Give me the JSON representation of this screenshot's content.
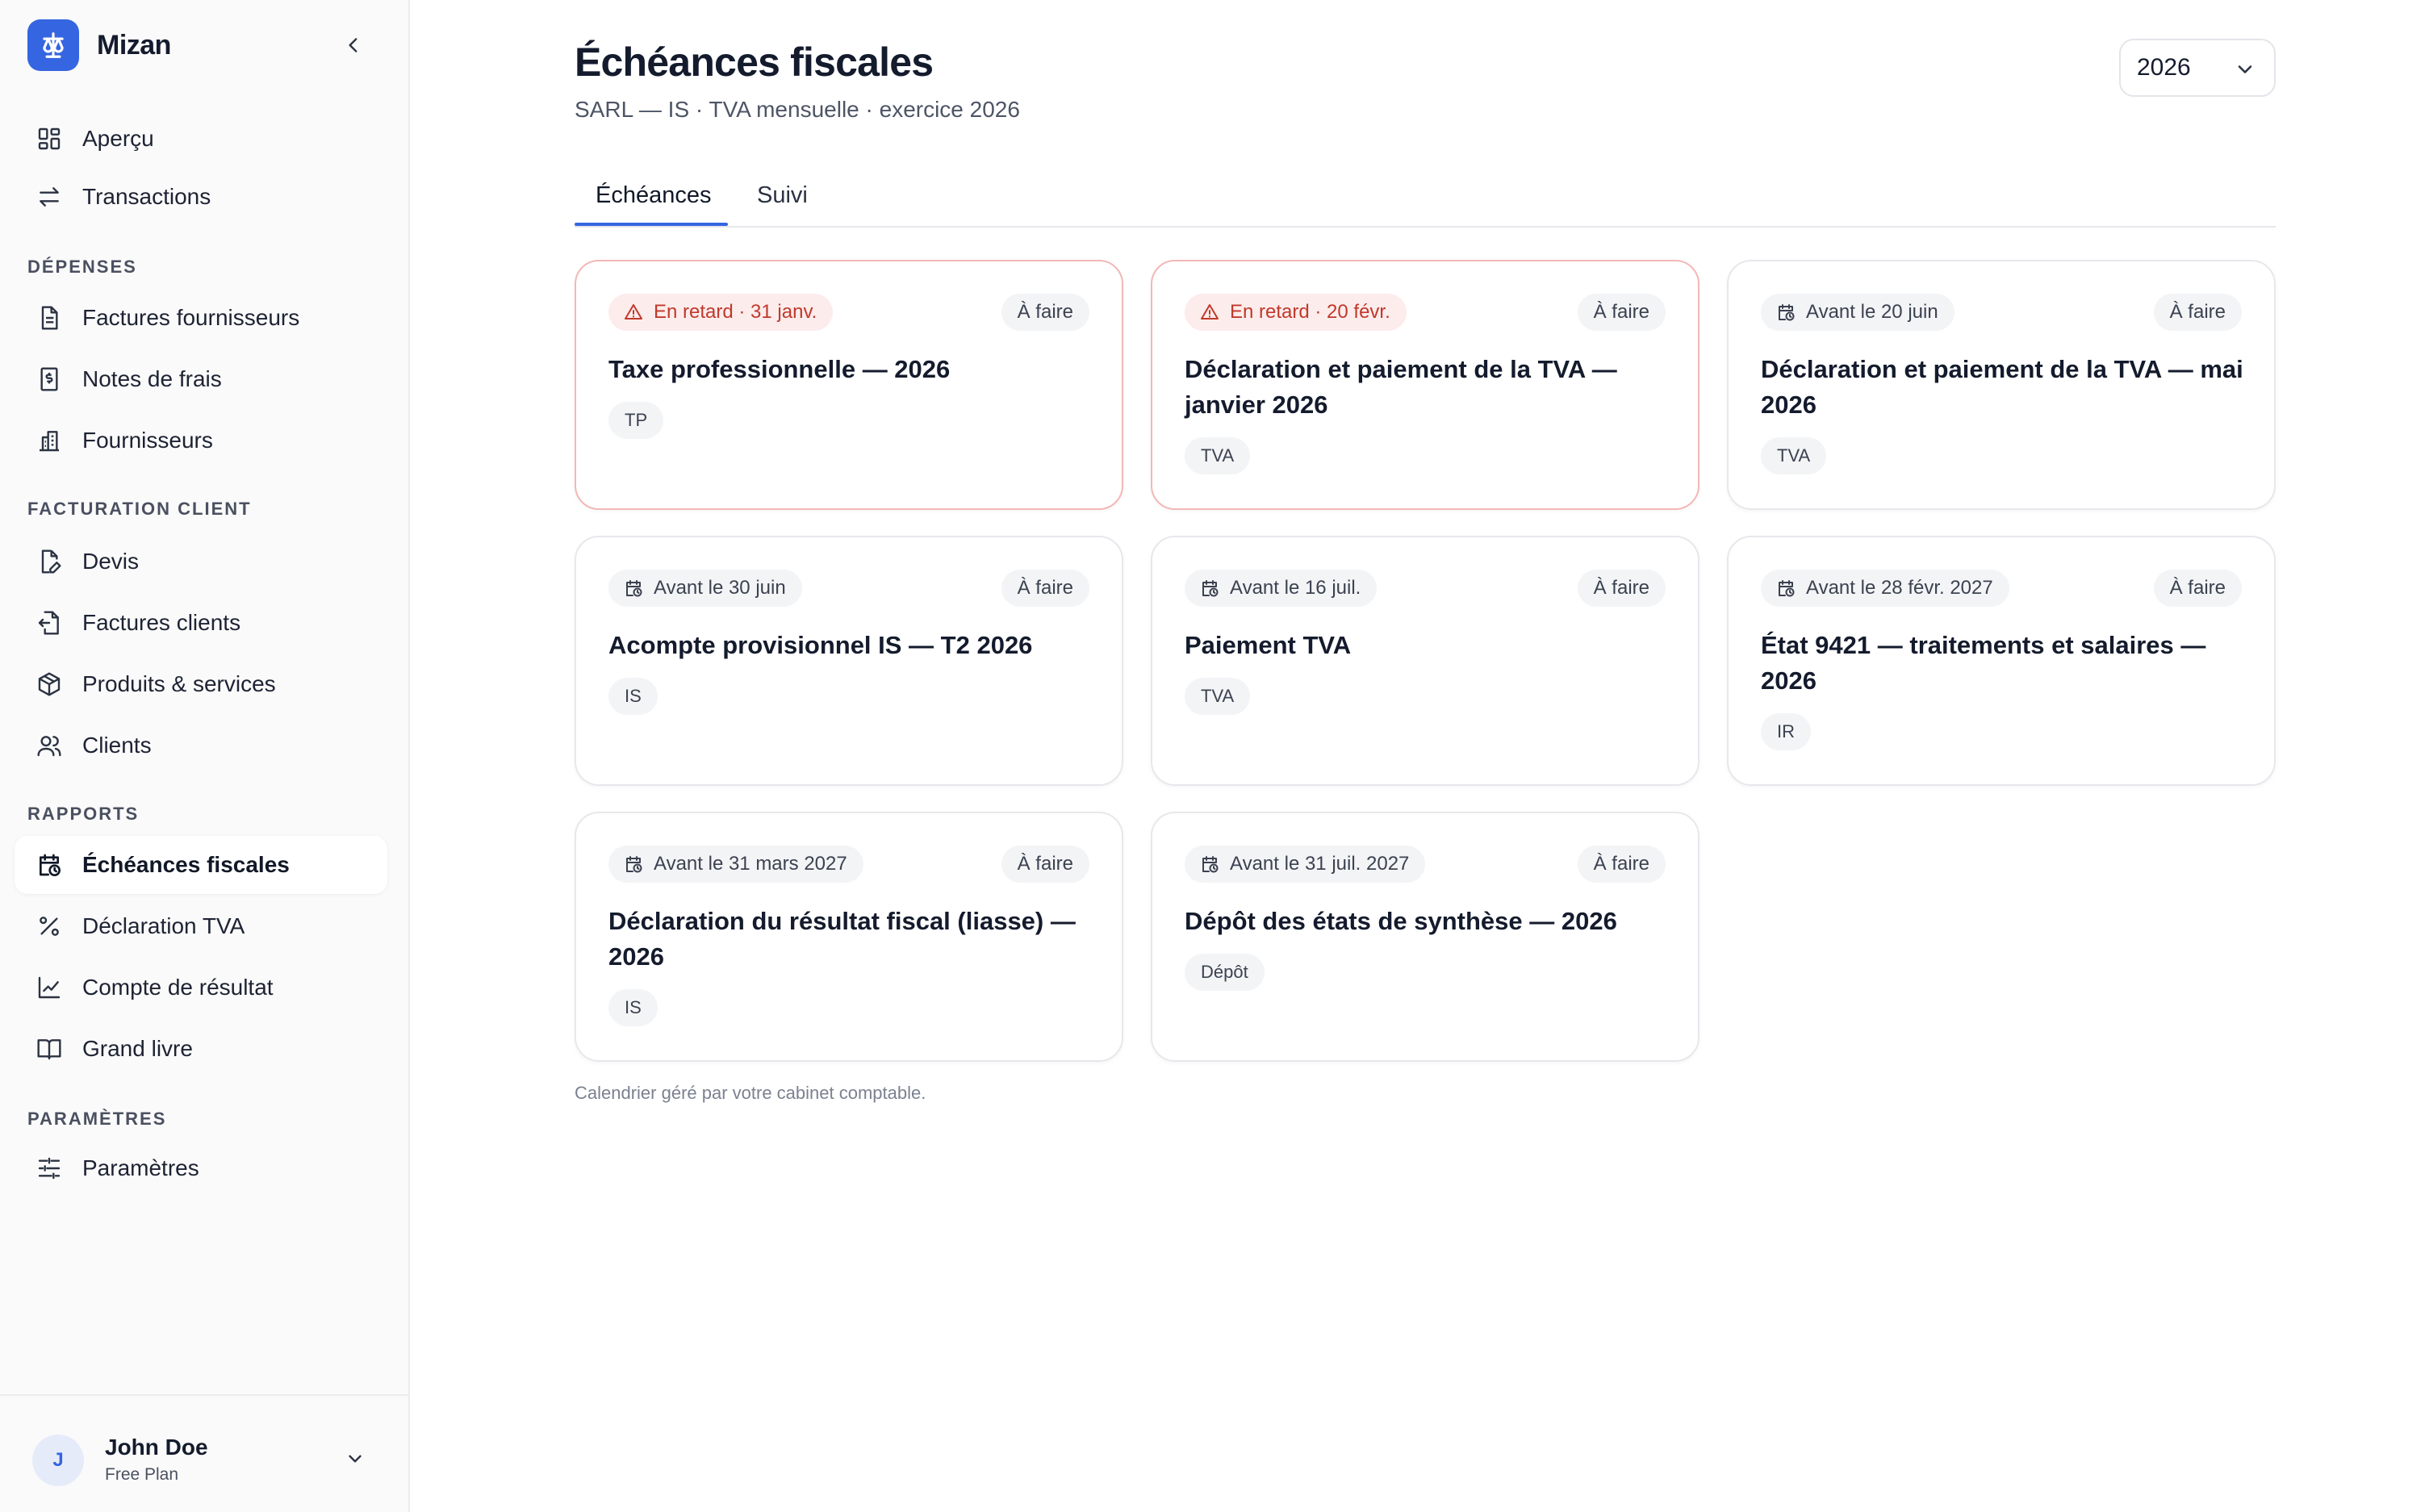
{
  "app": {
    "name": "Mizan"
  },
  "nav": {
    "top": [
      {
        "label": "Aperçu",
        "icon": "grid-icon"
      },
      {
        "label": "Transactions",
        "icon": "arrows-left-right-icon"
      }
    ],
    "sections": [
      {
        "title": "DÉPENSES",
        "items": [
          {
            "label": "Factures fournisseurs",
            "icon": "document-icon"
          },
          {
            "label": "Notes de frais",
            "icon": "receipt-dollar-icon"
          },
          {
            "label": "Fournisseurs",
            "icon": "building-icon"
          }
        ]
      },
      {
        "title": "FACTURATION CLIENT",
        "items": [
          {
            "label": "Devis",
            "icon": "document-edit-icon"
          },
          {
            "label": "Factures clients",
            "icon": "document-export-icon"
          },
          {
            "label": "Produits & services",
            "icon": "package-icon"
          },
          {
            "label": "Clients",
            "icon": "users-icon"
          }
        ]
      },
      {
        "title": "RAPPORTS",
        "items": [
          {
            "label": "Échéances fiscales",
            "icon": "calendar-clock-icon",
            "active": true
          },
          {
            "label": "Déclaration TVA",
            "icon": "percent-icon"
          },
          {
            "label": "Compte de résultat",
            "icon": "line-chart-icon"
          },
          {
            "label": "Grand livre",
            "icon": "book-icon"
          }
        ]
      },
      {
        "title": "PARAMÈTRES",
        "items": [
          {
            "label": "Paramètres",
            "icon": "sliders-icon"
          }
        ]
      }
    ]
  },
  "user": {
    "initial": "J",
    "name": "John Doe",
    "plan": "Free Plan"
  },
  "header": {
    "title": "Échéances fiscales",
    "subtitle": "SARL — IS · TVA mensuelle · exercice 2026",
    "year": "2026"
  },
  "tabs": [
    {
      "label": "Échéances",
      "active": true
    },
    {
      "label": "Suivi",
      "active": false
    }
  ],
  "cards": [
    {
      "due": "En retard · 31 janv.",
      "late": true,
      "status": "À faire",
      "title": "Taxe professionnelle — 2026",
      "tag": "TP"
    },
    {
      "due": "En retard · 20 févr.",
      "late": true,
      "status": "À faire",
      "title": "Déclaration et paiement de la TVA — janvier 2026",
      "tag": "TVA"
    },
    {
      "due": "Avant le 20 juin",
      "late": false,
      "status": "À faire",
      "title": "Déclaration et paiement de la TVA — mai 2026",
      "tag": "TVA"
    },
    {
      "due": "Avant le 30 juin",
      "late": false,
      "status": "À faire",
      "title": "Acompte provisionnel IS — T2 2026",
      "tag": "IS"
    },
    {
      "due": "Avant le 16 juil.",
      "late": false,
      "status": "À faire",
      "title": "Paiement TVA",
      "tag": "TVA"
    },
    {
      "due": "Avant le 28 févr. 2027",
      "late": false,
      "status": "À faire",
      "title": "État 9421 — traitements et salaires — 2026",
      "tag": "IR"
    },
    {
      "due": "Avant le 31 mars 2027",
      "late": false,
      "status": "À faire",
      "title": "Déclaration du résultat fiscal (liasse) — 2026",
      "tag": "IS"
    },
    {
      "due": "Avant le 31 juil. 2027",
      "late": false,
      "status": "À faire",
      "title": "Dépôt des états de synthèse — 2026",
      "tag": "Dépôt"
    }
  ],
  "footnote": "Calendrier géré par votre cabinet comptable.",
  "colors": {
    "accent": "#3565e0",
    "late_text": "#c0392b",
    "late_bg": "#fdecec",
    "late_border": "#f3b8b5"
  }
}
